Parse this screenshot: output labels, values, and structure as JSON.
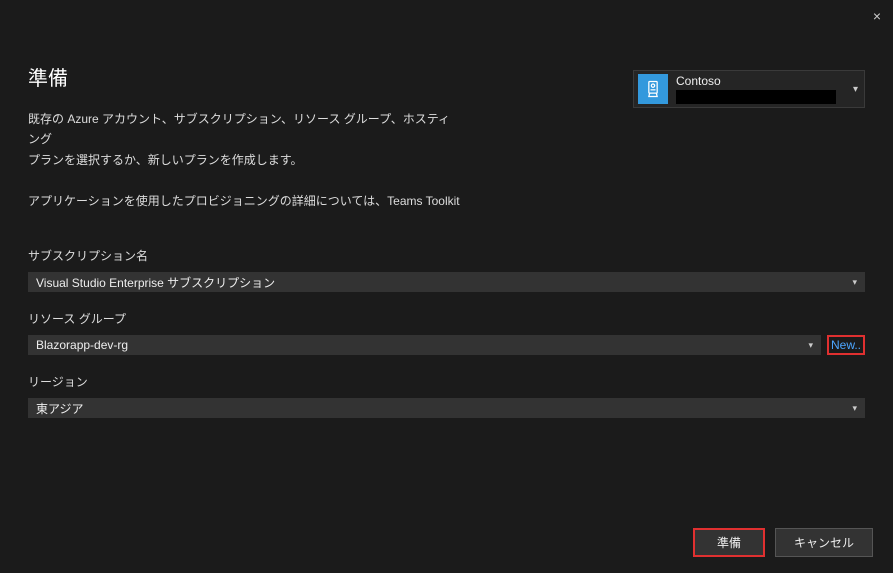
{
  "close_label": "×",
  "title": "準備",
  "description_line1": "既存の Azure アカウント、サブスクリプション、リソース グループ、ホスティング",
  "description_line2": "プランを選択するか、新しいプランを作成します。",
  "subtext": "アプリケーションを使用したプロビジョニングの詳細については、Teams Toolkit",
  "account": {
    "name": "Contoso"
  },
  "fields": {
    "subscription": {
      "label": "サブスクリプション名",
      "value": "Visual Studio Enterprise サブスクリプション"
    },
    "resource_group": {
      "label": "リソース グループ",
      "value": "Blazorapp-dev-rg",
      "new_link": "New.."
    },
    "region": {
      "label": "リージョン",
      "value": "東アジア"
    }
  },
  "buttons": {
    "primary": "準備",
    "cancel": "キャンセル"
  }
}
